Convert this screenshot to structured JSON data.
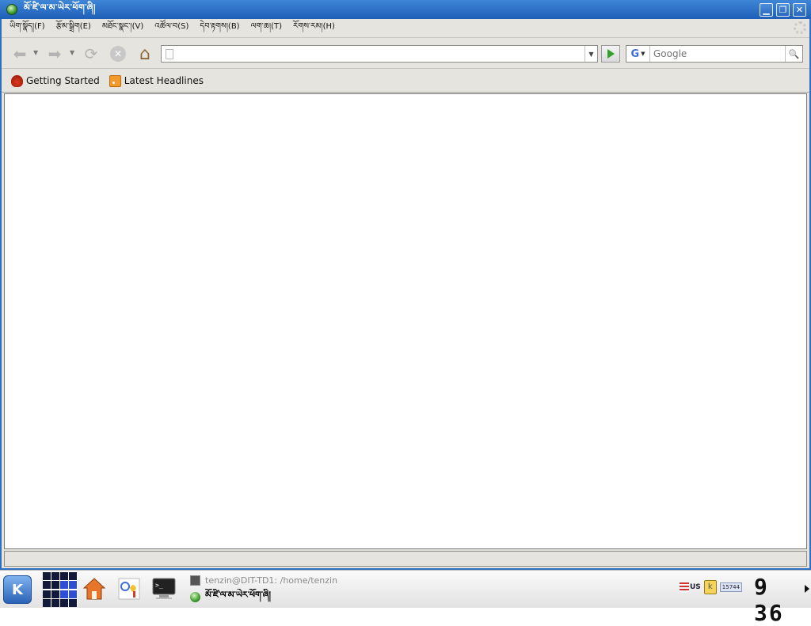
{
  "window": {
    "title": "མོ་ཛི་ལ་མ་ཡེར་ཕོག་ཞི།",
    "buttons": {
      "minimize": "▁",
      "maximize": "❐",
      "close": "✕"
    }
  },
  "menubar": {
    "items": [
      {
        "label": "ཡིག་སྣོད།(F)"
      },
      {
        "label": "རྩོམ་སྒྲིག(E)"
      },
      {
        "label": "མཐོང་སྣང་།(V)"
      },
      {
        "label": "འཚོལ་བ(S)"
      },
      {
        "label": "དེབ་རྟགས།(B)"
      },
      {
        "label": "ལག་ཆ།(T)"
      },
      {
        "label": "རོགས་རམ།(H)"
      }
    ]
  },
  "navbar": {
    "url_value": "",
    "search_engine": "G",
    "search_placeholder": "Google",
    "icons": {
      "back": "⬅",
      "forward": "➡",
      "reload": "⟳",
      "stop": "✕",
      "home": "⌂",
      "search": "🔍"
    }
  },
  "bookmarks": [
    {
      "label": "Getting Started",
      "icon": "firefox-icon"
    },
    {
      "label": "Latest Headlines",
      "icon": "rss-icon"
    }
  ],
  "statusbar": {
    "text": ""
  },
  "taskbar": {
    "kmenu_label": "K",
    "tasks": [
      {
        "label": "tenzin@DIT-TD1: /home/tenzin"
      },
      {
        "label": "མོ་ཛི་ལ་མ་ཡེར་ཕོག་ཞི།"
      }
    ],
    "tray": {
      "keyboard_layout": "US",
      "badge_number": "15744"
    },
    "clock": "9 36"
  },
  "colors": {
    "titlebar": "#2a6ac5",
    "taskbar": "#ececec",
    "pager_active": "#2e4ed6"
  }
}
